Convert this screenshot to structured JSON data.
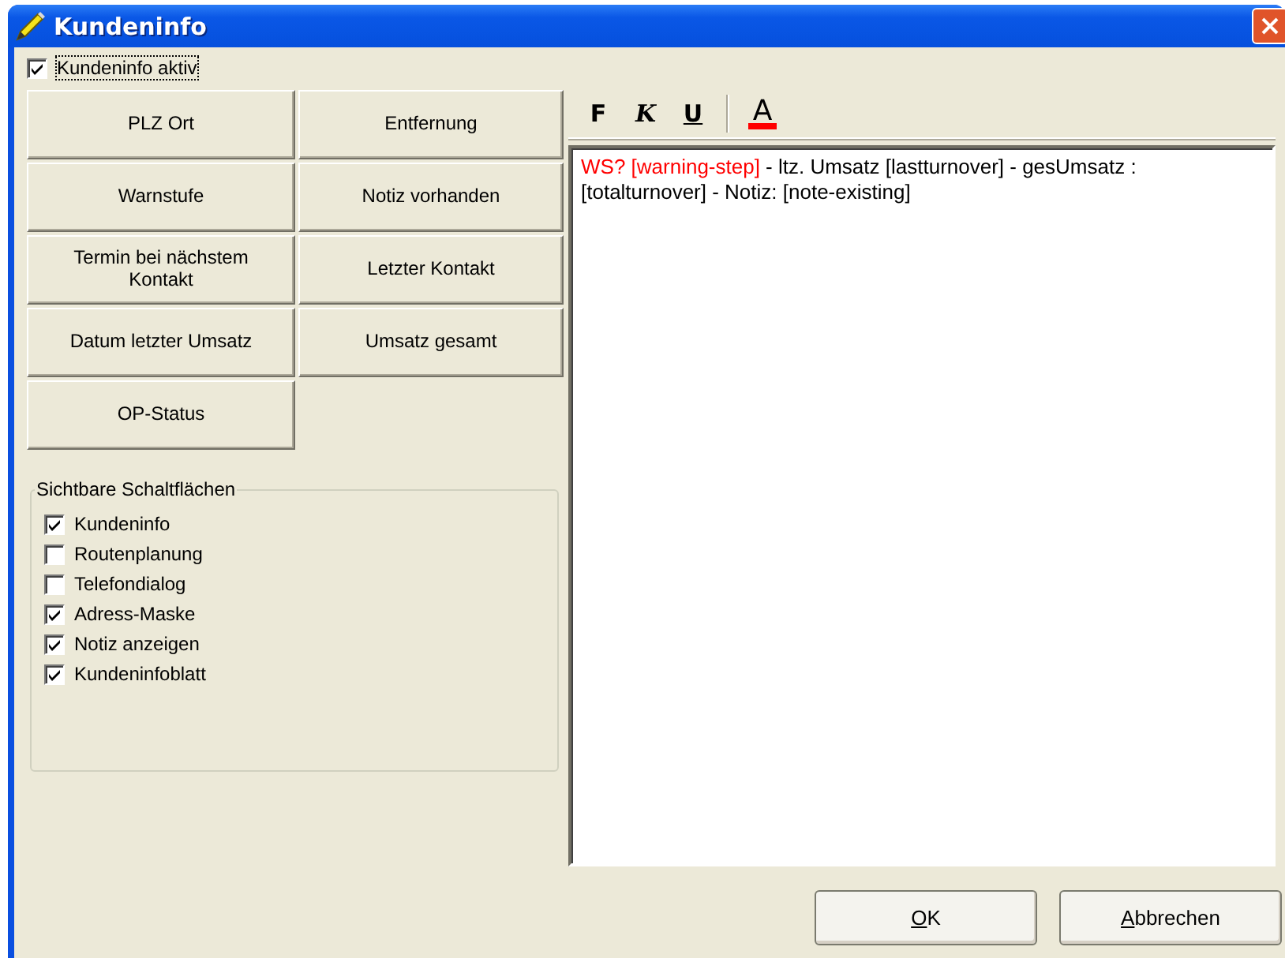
{
  "window": {
    "title": "Kundeninfo"
  },
  "active_checkbox": {
    "label": "Kundeninfo aktiv",
    "checked": true
  },
  "field_buttons": [
    "PLZ Ort",
    "Entfernung",
    "Warnstufe",
    "Notiz vorhanden",
    "Termin bei nächstem Kontakt",
    "Letzter Kontakt",
    "Datum letzter Umsatz",
    "Umsatz gesamt",
    "OP-Status"
  ],
  "visible_buttons_group": {
    "title": "Sichtbare Schaltflächen",
    "items": [
      {
        "label": "Kundeninfo",
        "checked": true
      },
      {
        "label": "Routenplanung",
        "checked": false
      },
      {
        "label": "Telefondialog",
        "checked": false
      },
      {
        "label": "Adress-Maske",
        "checked": true
      },
      {
        "label": "Notiz anzeigen",
        "checked": true
      },
      {
        "label": "Kundeninfoblatt",
        "checked": true
      }
    ]
  },
  "toolbar": [
    {
      "label": "F",
      "kind": "bold"
    },
    {
      "label": "K",
      "kind": "italic"
    },
    {
      "label": "U",
      "kind": "underline"
    },
    {
      "label": "A",
      "kind": "color",
      "color": "#ff0000"
    }
  ],
  "editor": {
    "segments": [
      {
        "text": "WS? [warning-step]",
        "color": "#ff0000"
      },
      {
        "text": " - ltz. Umsatz [lastturnover] - gesUmsatz : [totalturnover] - Notiz: [note-existing]",
        "color": "#000000"
      }
    ]
  },
  "buttons": [
    "OK",
    "Abbrechen"
  ]
}
